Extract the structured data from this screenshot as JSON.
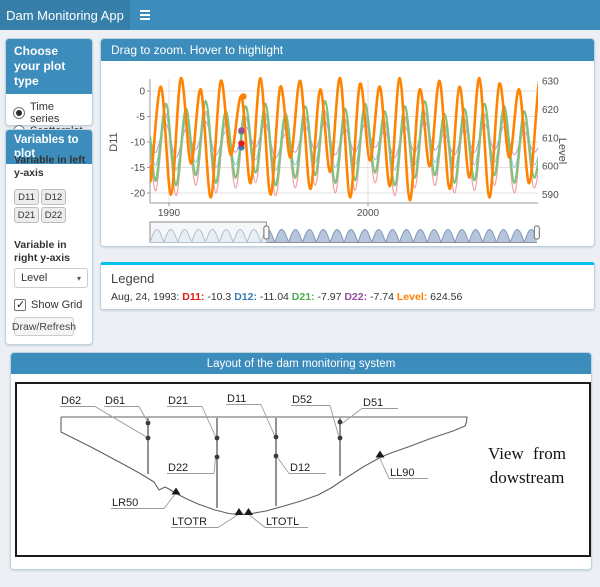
{
  "navbar": {
    "title": "Dam Monitoring App"
  },
  "colors": {
    "accent": "#3c8dbc",
    "logo_bg": "#367fa9",
    "legend_border": "#00c0ef",
    "page_bg": "#ecf0f5"
  },
  "sidebar": {
    "plot_type_panel": {
      "title": "Choose your plot type",
      "options": [
        {
          "label": "Time series",
          "selected": true
        },
        {
          "label": "Scatterplot",
          "selected": false
        }
      ]
    },
    "variables_panel": {
      "title": "Variables to plot",
      "left_axis_label": "Variable in left y-axis",
      "left_axis_buttons": [
        "D11",
        "D12",
        "D21",
        "D22"
      ],
      "right_axis_label": "Variable in right y-axis",
      "right_axis_selected": "Level",
      "show_grid_label": "Show Grid",
      "show_grid_checked": true,
      "draw_button": "Draw/Refresh"
    }
  },
  "chart_box": {
    "title": "Drag to zoom. Hover to highlight"
  },
  "chart_data": {
    "type": "line",
    "x_range": [
      1989.05,
      2008.55
    ],
    "x_ticks": [
      1990,
      2000
    ],
    "grid": true,
    "left_axis": {
      "title": "D11",
      "ticks": [
        0,
        -5,
        -10,
        -15,
        -20
      ],
      "range": [
        2.4,
        -22
      ]
    },
    "right_axis": {
      "title": "Level",
      "ticks": [
        630,
        620,
        610,
        600,
        590
      ],
      "range": [
        633,
        589
      ]
    },
    "highlight": {
      "date": "Aug, 24, 1993",
      "x": 1993.64,
      "values": {
        "D11": -10.3,
        "D12": -11.04,
        "D21": -7.97,
        "D22": -7.74,
        "Level": 624.56
      }
    },
    "range_selector": {
      "window_start_frac": 0.3,
      "window_end_frac": 0.997
    },
    "series": [
      {
        "name": "D11",
        "axis": "left",
        "legend_color": "#e41a1c",
        "line_color": "#f0a0a2",
        "width": 1.2,
        "points": [
          [
            1989.05,
            -11
          ],
          [
            1989.35,
            -19.5
          ],
          [
            1989.85,
            -4.5
          ],
          [
            1990.35,
            -20.5
          ],
          [
            1990.85,
            -5.5
          ],
          [
            1991.35,
            -18.5
          ],
          [
            1991.85,
            -4
          ],
          [
            1992.35,
            -20
          ],
          [
            1992.85,
            -6
          ],
          [
            1993.35,
            -19
          ],
          [
            1993.85,
            -5
          ],
          [
            1994.35,
            -18
          ],
          [
            1994.85,
            -4.5
          ],
          [
            1995.35,
            -20.5
          ],
          [
            1995.85,
            -6.5
          ],
          [
            1996.35,
            -19
          ],
          [
            1996.85,
            -5
          ],
          [
            1997.35,
            -18.5
          ],
          [
            1997.85,
            -4
          ],
          [
            1998.35,
            -20
          ],
          [
            1998.85,
            -5.5
          ],
          [
            1999.35,
            -19.5
          ],
          [
            1999.85,
            -4.5
          ],
          [
            2000.35,
            -18
          ],
          [
            2000.85,
            -6
          ],
          [
            2001.35,
            -20.5
          ],
          [
            2001.85,
            -5
          ],
          [
            2002.35,
            -19
          ],
          [
            2002.85,
            -4
          ],
          [
            2003.35,
            -18.5
          ],
          [
            2003.85,
            -6.5
          ],
          [
            2004.35,
            -20
          ],
          [
            2004.85,
            -5.5
          ],
          [
            2005.35,
            -19.5
          ],
          [
            2005.85,
            -4.5
          ],
          [
            2006.35,
            -18.5
          ],
          [
            2006.85,
            -5
          ],
          [
            2007.35,
            -20
          ],
          [
            2007.85,
            -6
          ],
          [
            2008.35,
            -19
          ],
          [
            2008.85,
            -7
          ]
        ]
      },
      {
        "name": "D12",
        "axis": "left",
        "legend_color": "#377eb8",
        "line_color": "#a6cbe8",
        "width": 1.2,
        "points": [
          [
            1989.05,
            -10
          ],
          [
            1989.35,
            -14.5
          ],
          [
            1989.85,
            -5
          ],
          [
            1990.35,
            -15.5
          ],
          [
            1990.85,
            -6
          ],
          [
            1991.35,
            -14
          ],
          [
            1991.85,
            -4.5
          ],
          [
            1992.35,
            -15
          ],
          [
            1992.85,
            -6.5
          ],
          [
            1993.35,
            -14.5
          ],
          [
            1993.85,
            -5.5
          ],
          [
            1994.35,
            -13.5
          ],
          [
            1994.85,
            -5
          ],
          [
            1995.35,
            -15.5
          ],
          [
            1995.85,
            -7
          ],
          [
            1996.35,
            -14.5
          ],
          [
            1996.85,
            -5.5
          ],
          [
            1997.35,
            -14
          ],
          [
            1997.85,
            -4.5
          ],
          [
            1998.35,
            -15
          ],
          [
            1998.85,
            -6
          ],
          [
            1999.35,
            -14.5
          ],
          [
            1999.85,
            -5
          ],
          [
            2000.35,
            -13.5
          ],
          [
            2000.85,
            -6.5
          ],
          [
            2001.35,
            -15.5
          ],
          [
            2001.85,
            -5.5
          ],
          [
            2002.35,
            -14.5
          ],
          [
            2002.85,
            -4.5
          ],
          [
            2003.35,
            -14
          ],
          [
            2003.85,
            -7
          ],
          [
            2004.35,
            -15
          ],
          [
            2004.85,
            -6
          ],
          [
            2005.35,
            -14.5
          ],
          [
            2005.85,
            -5
          ],
          [
            2006.35,
            -14
          ],
          [
            2006.85,
            -5.5
          ],
          [
            2007.35,
            -15
          ],
          [
            2007.85,
            -6.5
          ],
          [
            2008.35,
            -14.5
          ],
          [
            2008.85,
            -7.5
          ]
        ]
      },
      {
        "name": "D22",
        "axis": "left",
        "legend_color": "#984ea3",
        "line_color": "#c9a7d9",
        "width": 1.2,
        "points": [
          [
            1989.05,
            -9.5
          ],
          [
            1989.35,
            -12
          ],
          [
            1989.85,
            -6.5
          ],
          [
            1990.35,
            -13
          ],
          [
            1990.85,
            -7.5
          ],
          [
            1991.35,
            -11.5
          ],
          [
            1991.85,
            -6
          ],
          [
            1992.35,
            -12.5
          ],
          [
            1992.85,
            -8
          ],
          [
            1993.35,
            -12
          ],
          [
            1993.85,
            -7
          ],
          [
            1994.35,
            -11
          ],
          [
            1994.85,
            -6.5
          ],
          [
            1995.35,
            -13
          ],
          [
            1995.85,
            -8.5
          ],
          [
            1996.35,
            -12
          ],
          [
            1996.85,
            -7
          ],
          [
            1997.35,
            -11.5
          ],
          [
            1997.85,
            -6
          ],
          [
            1998.35,
            -12.5
          ],
          [
            1998.85,
            -7.5
          ],
          [
            1999.35,
            -12
          ],
          [
            1999.85,
            -6.5
          ],
          [
            2000.35,
            -11
          ],
          [
            2000.85,
            -8
          ],
          [
            2001.35,
            -13
          ],
          [
            2001.85,
            -7
          ],
          [
            2002.35,
            -12
          ],
          [
            2002.85,
            -6
          ],
          [
            2003.35,
            -11.5
          ],
          [
            2003.85,
            -8.5
          ],
          [
            2004.35,
            -12.5
          ],
          [
            2004.85,
            -7.5
          ],
          [
            2005.35,
            -12
          ],
          [
            2005.85,
            -6.5
          ],
          [
            2006.35,
            -11.5
          ],
          [
            2006.85,
            -7
          ],
          [
            2007.35,
            -12.5
          ],
          [
            2007.85,
            -8
          ],
          [
            2008.35,
            -12
          ],
          [
            2008.85,
            -8.5
          ]
        ]
      },
      {
        "name": "D21",
        "axis": "left",
        "legend_color": "#4daf4a",
        "line_color": "#7cc47e",
        "width": 2.2,
        "points": [
          [
            1989.05,
            -9
          ],
          [
            1989.35,
            -17.5
          ],
          [
            1989.85,
            -2.5
          ],
          [
            1990.35,
            -18.5
          ],
          [
            1990.85,
            -3.5
          ],
          [
            1991.35,
            -16.5
          ],
          [
            1991.85,
            -2
          ],
          [
            1992.35,
            -18
          ],
          [
            1992.85,
            -4
          ],
          [
            1993.35,
            -17
          ],
          [
            1993.85,
            -3
          ],
          [
            1994.35,
            -16
          ],
          [
            1994.85,
            -2.5
          ],
          [
            1995.35,
            -18.5
          ],
          [
            1995.85,
            -4.5
          ],
          [
            1996.35,
            -17
          ],
          [
            1996.85,
            -3
          ],
          [
            1997.35,
            -16.5
          ],
          [
            1997.85,
            -2
          ],
          [
            1998.35,
            -18
          ],
          [
            1998.85,
            -3.5
          ],
          [
            1999.35,
            -17.5
          ],
          [
            1999.85,
            -2.5
          ],
          [
            2000.35,
            -16
          ],
          [
            2000.85,
            -4
          ],
          [
            2001.35,
            -18.5
          ],
          [
            2001.85,
            -3
          ],
          [
            2002.35,
            -17
          ],
          [
            2002.85,
            -2
          ],
          [
            2003.35,
            -16.5
          ],
          [
            2003.85,
            -4.5
          ],
          [
            2004.35,
            -18
          ],
          [
            2004.85,
            -3.5
          ],
          [
            2005.35,
            -17.5
          ],
          [
            2005.85,
            -2.5
          ],
          [
            2006.35,
            -16.5
          ],
          [
            2006.85,
            -3
          ],
          [
            2007.35,
            -18
          ],
          [
            2007.85,
            -4
          ],
          [
            2008.35,
            -17
          ],
          [
            2008.85,
            -5
          ]
        ]
      },
      {
        "name": "Level",
        "axis": "right",
        "legend_color": "#ff7f00",
        "line_color": "#ff8300",
        "width": 2.6,
        "points": [
          [
            1989.05,
            600
          ],
          [
            1989.1,
            596
          ],
          [
            1989.6,
            628
          ],
          [
            1990.1,
            590
          ],
          [
            1990.6,
            631
          ],
          [
            1991.1,
            601
          ],
          [
            1991.6,
            627
          ],
          [
            1992.1,
            589
          ],
          [
            1992.6,
            630
          ],
          [
            1993.1,
            604
          ],
          [
            1993.64,
            624.56
          ],
          [
            1994.1,
            594
          ],
          [
            1994.6,
            631
          ],
          [
            1995.1,
            590
          ],
          [
            1995.6,
            628
          ],
          [
            1996.1,
            603
          ],
          [
            1996.6,
            630
          ],
          [
            1997.1,
            592
          ],
          [
            1997.6,
            627
          ],
          [
            1998.1,
            598
          ],
          [
            1998.6,
            631
          ],
          [
            1999.1,
            589
          ],
          [
            1999.6,
            629
          ],
          [
            2000.1,
            602
          ],
          [
            2000.6,
            628
          ],
          [
            2001.1,
            593
          ],
          [
            2001.6,
            631
          ],
          [
            2002.1,
            588
          ],
          [
            2002.6,
            627
          ],
          [
            2003.1,
            600
          ],
          [
            2003.6,
            630
          ],
          [
            2004.1,
            592
          ],
          [
            2004.6,
            628
          ],
          [
            2005.1,
            596
          ],
          [
            2005.6,
            631
          ],
          [
            2006.1,
            589
          ],
          [
            2006.6,
            629
          ],
          [
            2007.1,
            603
          ],
          [
            2007.6,
            627
          ],
          [
            2008.1,
            594
          ],
          [
            2008.6,
            630
          ],
          [
            2008.85,
            622
          ]
        ]
      }
    ]
  },
  "legend_box": {
    "title": "Legend",
    "date_prefix": "Aug, 24, 1993:",
    "entries": [
      {
        "label": "D11:",
        "value": "-10.3",
        "color": "#e41a1c"
      },
      {
        "label": "D12:",
        "value": "-11.04",
        "color": "#377eb8"
      },
      {
        "label": "D21:",
        "value": "-7.97",
        "color": "#4daf4a"
      },
      {
        "label": "D22:",
        "value": "-7.74",
        "color": "#984ea3"
      },
      {
        "label": "Level:",
        "value": "624.56",
        "color": "#ff7f00"
      }
    ]
  },
  "layout_box": {
    "title": "Layout of the dam monitoring system",
    "sensor_labels": [
      "D62",
      "D61",
      "D21",
      "D11",
      "D52",
      "D51",
      "D22",
      "D12",
      "LR50",
      "LL90",
      "LTOTR",
      "LTOTL"
    ],
    "note_line1": "View from",
    "note_line2": "dowstream"
  }
}
